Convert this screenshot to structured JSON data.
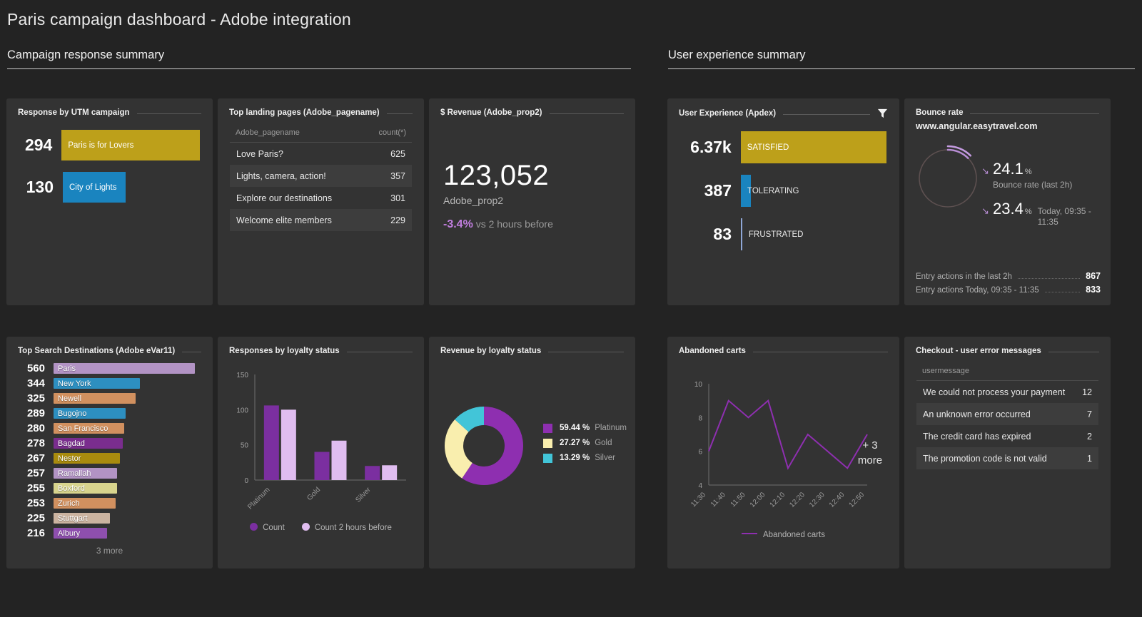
{
  "dashboard": {
    "title": "Paris campaign dashboard - Adobe integration"
  },
  "sections": [
    {
      "label": "Campaign response summary"
    },
    {
      "label": "User experience summary"
    }
  ],
  "colors": {
    "page_bg": "#232323",
    "tile_bg": "#333333",
    "gold": "#bda01a",
    "blue": "#1a84bf",
    "purple": "#8e2fb0",
    "purple_light": "#e0bdf0",
    "purple_mid": "#b48ec6",
    "teal": "#42c5d8",
    "yellow_pale": "#f7eeaa",
    "accent_text": "#c27fe0"
  },
  "utm_tile": {
    "title": "Response by UTM campaign",
    "rows": [
      {
        "value": "294",
        "label": "Paris is for Lovers",
        "pct": 100,
        "color": "#bda01a"
      },
      {
        "value": "130",
        "label": "City of Lights",
        "pct": 44,
        "color": "#1a84bf"
      }
    ]
  },
  "landing_tile": {
    "title": "Top landing pages (Adobe_pagename)",
    "columns": [
      "Adobe_pagename",
      "count(*)"
    ],
    "rows": [
      {
        "name": "Love  Paris?",
        "count": "625"
      },
      {
        "name": "Lights, camera, action!",
        "count": "357"
      },
      {
        "name": "Explore our destinations",
        "count": "301"
      },
      {
        "name": "Welcome elite members",
        "count": "229"
      }
    ]
  },
  "revenue_tile": {
    "title": "$ Revenue (Adobe_prop2)",
    "value": "123,052",
    "subtitle": "Adobe_prop2",
    "delta": "-3.4%",
    "delta_caption": "vs 2 hours before"
  },
  "apdex_tile": {
    "title": "User Experience (Apdex)",
    "filter_icon": "funnel-icon",
    "rows": [
      {
        "value": "6.37k",
        "label": "SATISFIED",
        "pct": 100,
        "color": "#bda01a"
      },
      {
        "value": "387",
        "label": "TOLERATING",
        "pct": 5.8,
        "color": "#1a84bf"
      },
      {
        "value": "83",
        "label": "FRUSTRATED",
        "pct": 1.2,
        "color": "#8fa7d6"
      }
    ]
  },
  "bounce_tile": {
    "title": "Bounce rate",
    "url": "www.angular.easytravel.com",
    "primary": {
      "value": "24.1",
      "unit": "%",
      "caption": "Bounce rate (last 2h)",
      "arc_pct": 24.1
    },
    "secondary": {
      "value": "23.4",
      "unit": "%",
      "caption": "Today, 09:35 - 11:35",
      "arc_pct": 23.4
    },
    "footer": [
      {
        "label": "Entry actions in the last 2h",
        "value": "867"
      },
      {
        "label": "Entry actions Today, 09:35 - 11:35",
        "value": "833"
      }
    ]
  },
  "search_tile": {
    "title": "Top Search Destinations (Adobe eVar11)",
    "more_label": "3 more",
    "rows": [
      {
        "value": "560",
        "label": "Paris",
        "pct": 100,
        "color": "#b293c4"
      },
      {
        "value": "344",
        "label": "New York",
        "pct": 61,
        "color": "#2d8fc0"
      },
      {
        "value": "325",
        "label": "Newell",
        "pct": 58,
        "color": "#d1905f"
      },
      {
        "value": "289",
        "label": "Bugojno",
        "pct": 51,
        "color": "#2d8fc0"
      },
      {
        "value": "280",
        "label": "San Francisco",
        "pct": 50,
        "color": "#d1905f"
      },
      {
        "value": "278",
        "label": "Bagdad",
        "pct": 49,
        "color": "#7a2d8e"
      },
      {
        "value": "267",
        "label": "Nestor",
        "pct": 47,
        "color": "#a98b0e"
      },
      {
        "value": "257",
        "label": "Ramallah",
        "pct": 45,
        "color": "#b293c4"
      },
      {
        "value": "255",
        "label": "Boxford",
        "pct": 45,
        "color": "#d8d48d"
      },
      {
        "value": "253",
        "label": "Zurich",
        "pct": 44,
        "color": "#d1905f"
      },
      {
        "value": "225",
        "label": "Stuttgart",
        "pct": 40,
        "color": "#cbb3a0"
      },
      {
        "value": "216",
        "label": "Albury",
        "pct": 38,
        "color": "#8e4fae"
      }
    ]
  },
  "responses_tile": {
    "title": "Responses by loyalty status",
    "chart_data": {
      "type": "bar",
      "title": "Responses by loyalty status",
      "categories": [
        "Platinum",
        "Gold",
        "Silver"
      ],
      "series": [
        {
          "name": "Count",
          "values": [
            106,
            40,
            20
          ],
          "color": "#7b2fa0"
        },
        {
          "name": "Count 2 hours before",
          "values": [
            100,
            56,
            21
          ],
          "color": "#e0bdf0"
        }
      ],
      "ylabel": "",
      "xlabel": "",
      "ylim": [
        0,
        150
      ],
      "yticks": [
        0,
        50,
        100,
        150
      ],
      "grid": false,
      "legend": "bottom"
    }
  },
  "revenue_loyalty_tile": {
    "title": "Revenue by loyalty status",
    "chart_data": {
      "type": "pie",
      "title": "Revenue by loyalty status",
      "labels": [
        "Platinum",
        "Gold",
        "Silver"
      ],
      "values": [
        59.44,
        27.27,
        13.29
      ],
      "value_labels": [
        "59.44 %",
        "27.27 %",
        "13.29 %"
      ],
      "colors": [
        "#8e2fb0",
        "#f9eeae",
        "#42c5d8"
      ],
      "legend": "right",
      "donut": true
    }
  },
  "carts_tile": {
    "title": "Abandoned carts",
    "more_badge": "+ 3\nmore",
    "more_badge_line1": "+ 3",
    "more_badge_line2": "more",
    "chart_data": {
      "type": "line",
      "title": "Abandoned carts",
      "x": [
        "11:30",
        "11:40",
        "11:50",
        "12:00",
        "12:10",
        "12:20",
        "12:30",
        "12:40",
        "12:50"
      ],
      "series": [
        {
          "name": "Abandoned carts",
          "values": [
            6,
            9,
            8,
            9,
            5,
            7,
            6,
            5,
            7
          ],
          "color": "#8e2fb0"
        }
      ],
      "ylim": [
        4,
        10
      ],
      "yticks": [
        4,
        6,
        8,
        10
      ],
      "xlabel": "",
      "ylabel": "",
      "grid": false,
      "legend": "bottom"
    }
  },
  "checkout_tile": {
    "title": "Checkout - user error messages",
    "columns": [
      "usermessage"
    ],
    "rows": [
      {
        "name": "We could not process your payment",
        "count": "12"
      },
      {
        "name": "An unknown error occurred",
        "count": "7"
      },
      {
        "name": "The credit card has expired",
        "count": "2"
      },
      {
        "name": "The promotion code is not valid",
        "count": "1"
      }
    ]
  }
}
